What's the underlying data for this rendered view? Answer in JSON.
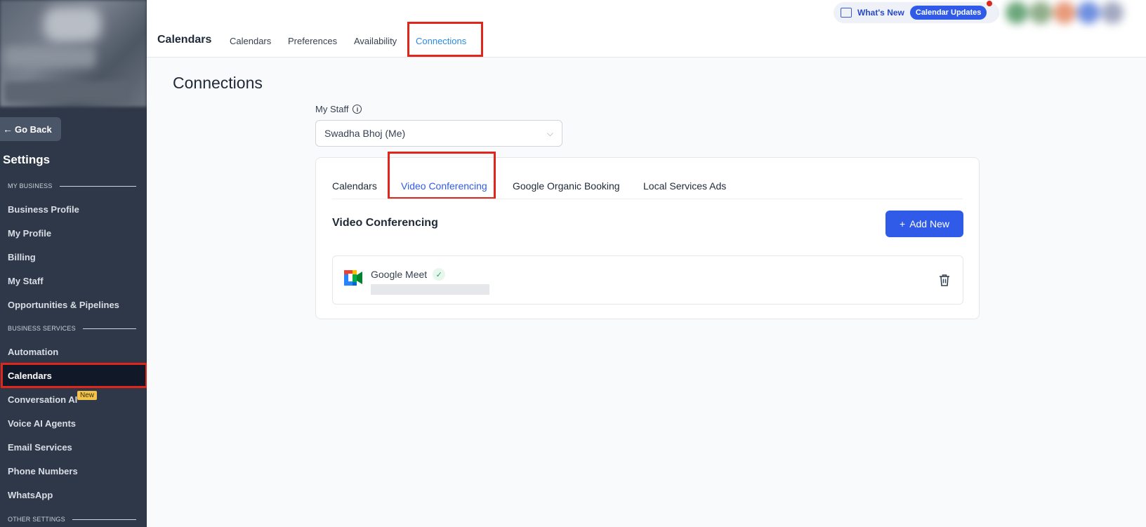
{
  "sidebar": {
    "go_back": "Go Back",
    "settings_title": "Settings",
    "sections": {
      "my_business": "MY BUSINESS",
      "business_services": "BUSINESS SERVICES",
      "other_settings": "OTHER SETTINGS"
    },
    "items": {
      "business_profile": "Business Profile",
      "my_profile": "My Profile",
      "billing": "Billing",
      "my_staff": "My Staff",
      "opportunities": "Opportunities & Pipelines",
      "automation": "Automation",
      "calendars": "Calendars",
      "conversation_ai": "Conversation AI",
      "voice_ai_agents": "Voice AI Agents",
      "email_services": "Email Services",
      "phone_numbers": "Phone Numbers",
      "whatsapp": "WhatsApp"
    },
    "new_badge": "New"
  },
  "header": {
    "title": "Calendars",
    "tabs": [
      "Calendars",
      "Preferences",
      "Availability",
      "Connections"
    ],
    "active_tab": "Connections",
    "whats_new": "What's New",
    "calendar_updates": "Calendar Updates"
  },
  "main": {
    "page_title": "Connections",
    "staff_label": "My Staff",
    "staff_selected": "Swadha Bhoj (Me)",
    "card_tabs": [
      "Calendars",
      "Video Conferencing",
      "Google Organic Booking",
      "Local Services Ads"
    ],
    "active_card_tab": "Video Conferencing",
    "section_title": "Video Conferencing",
    "add_new": "Add New",
    "connection": {
      "name": "Google Meet",
      "connected": true
    }
  },
  "colors": {
    "accent": "#2f5be8",
    "sidebar_bg": "#2f3848",
    "highlight": "#e0261a",
    "active_header_tab": "#2a8ce0"
  }
}
